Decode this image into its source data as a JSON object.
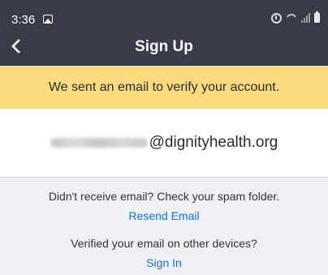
{
  "status_bar": {
    "time": "3:36",
    "icons": [
      "gallery-icon",
      "alarm-icon",
      "wifi-icon",
      "signal-icon",
      "battery-icon"
    ]
  },
  "nav": {
    "title": "Sign Up",
    "back_icon": "chevron-left-icon"
  },
  "banner": {
    "text": "We sent an email to verify your account.",
    "background": "#fbdb80"
  },
  "email": {
    "domain": "@dignityhealth.org"
  },
  "spam": {
    "hint": "Didn't receive email? Check your spam folder.",
    "link": "Resend Email"
  },
  "verified": {
    "hint": "Verified your email on other devices?",
    "link": "Sign In"
  },
  "colors": {
    "header": "#3a3b4a",
    "link": "#1a73c9",
    "page_background": "#eef0f3"
  }
}
